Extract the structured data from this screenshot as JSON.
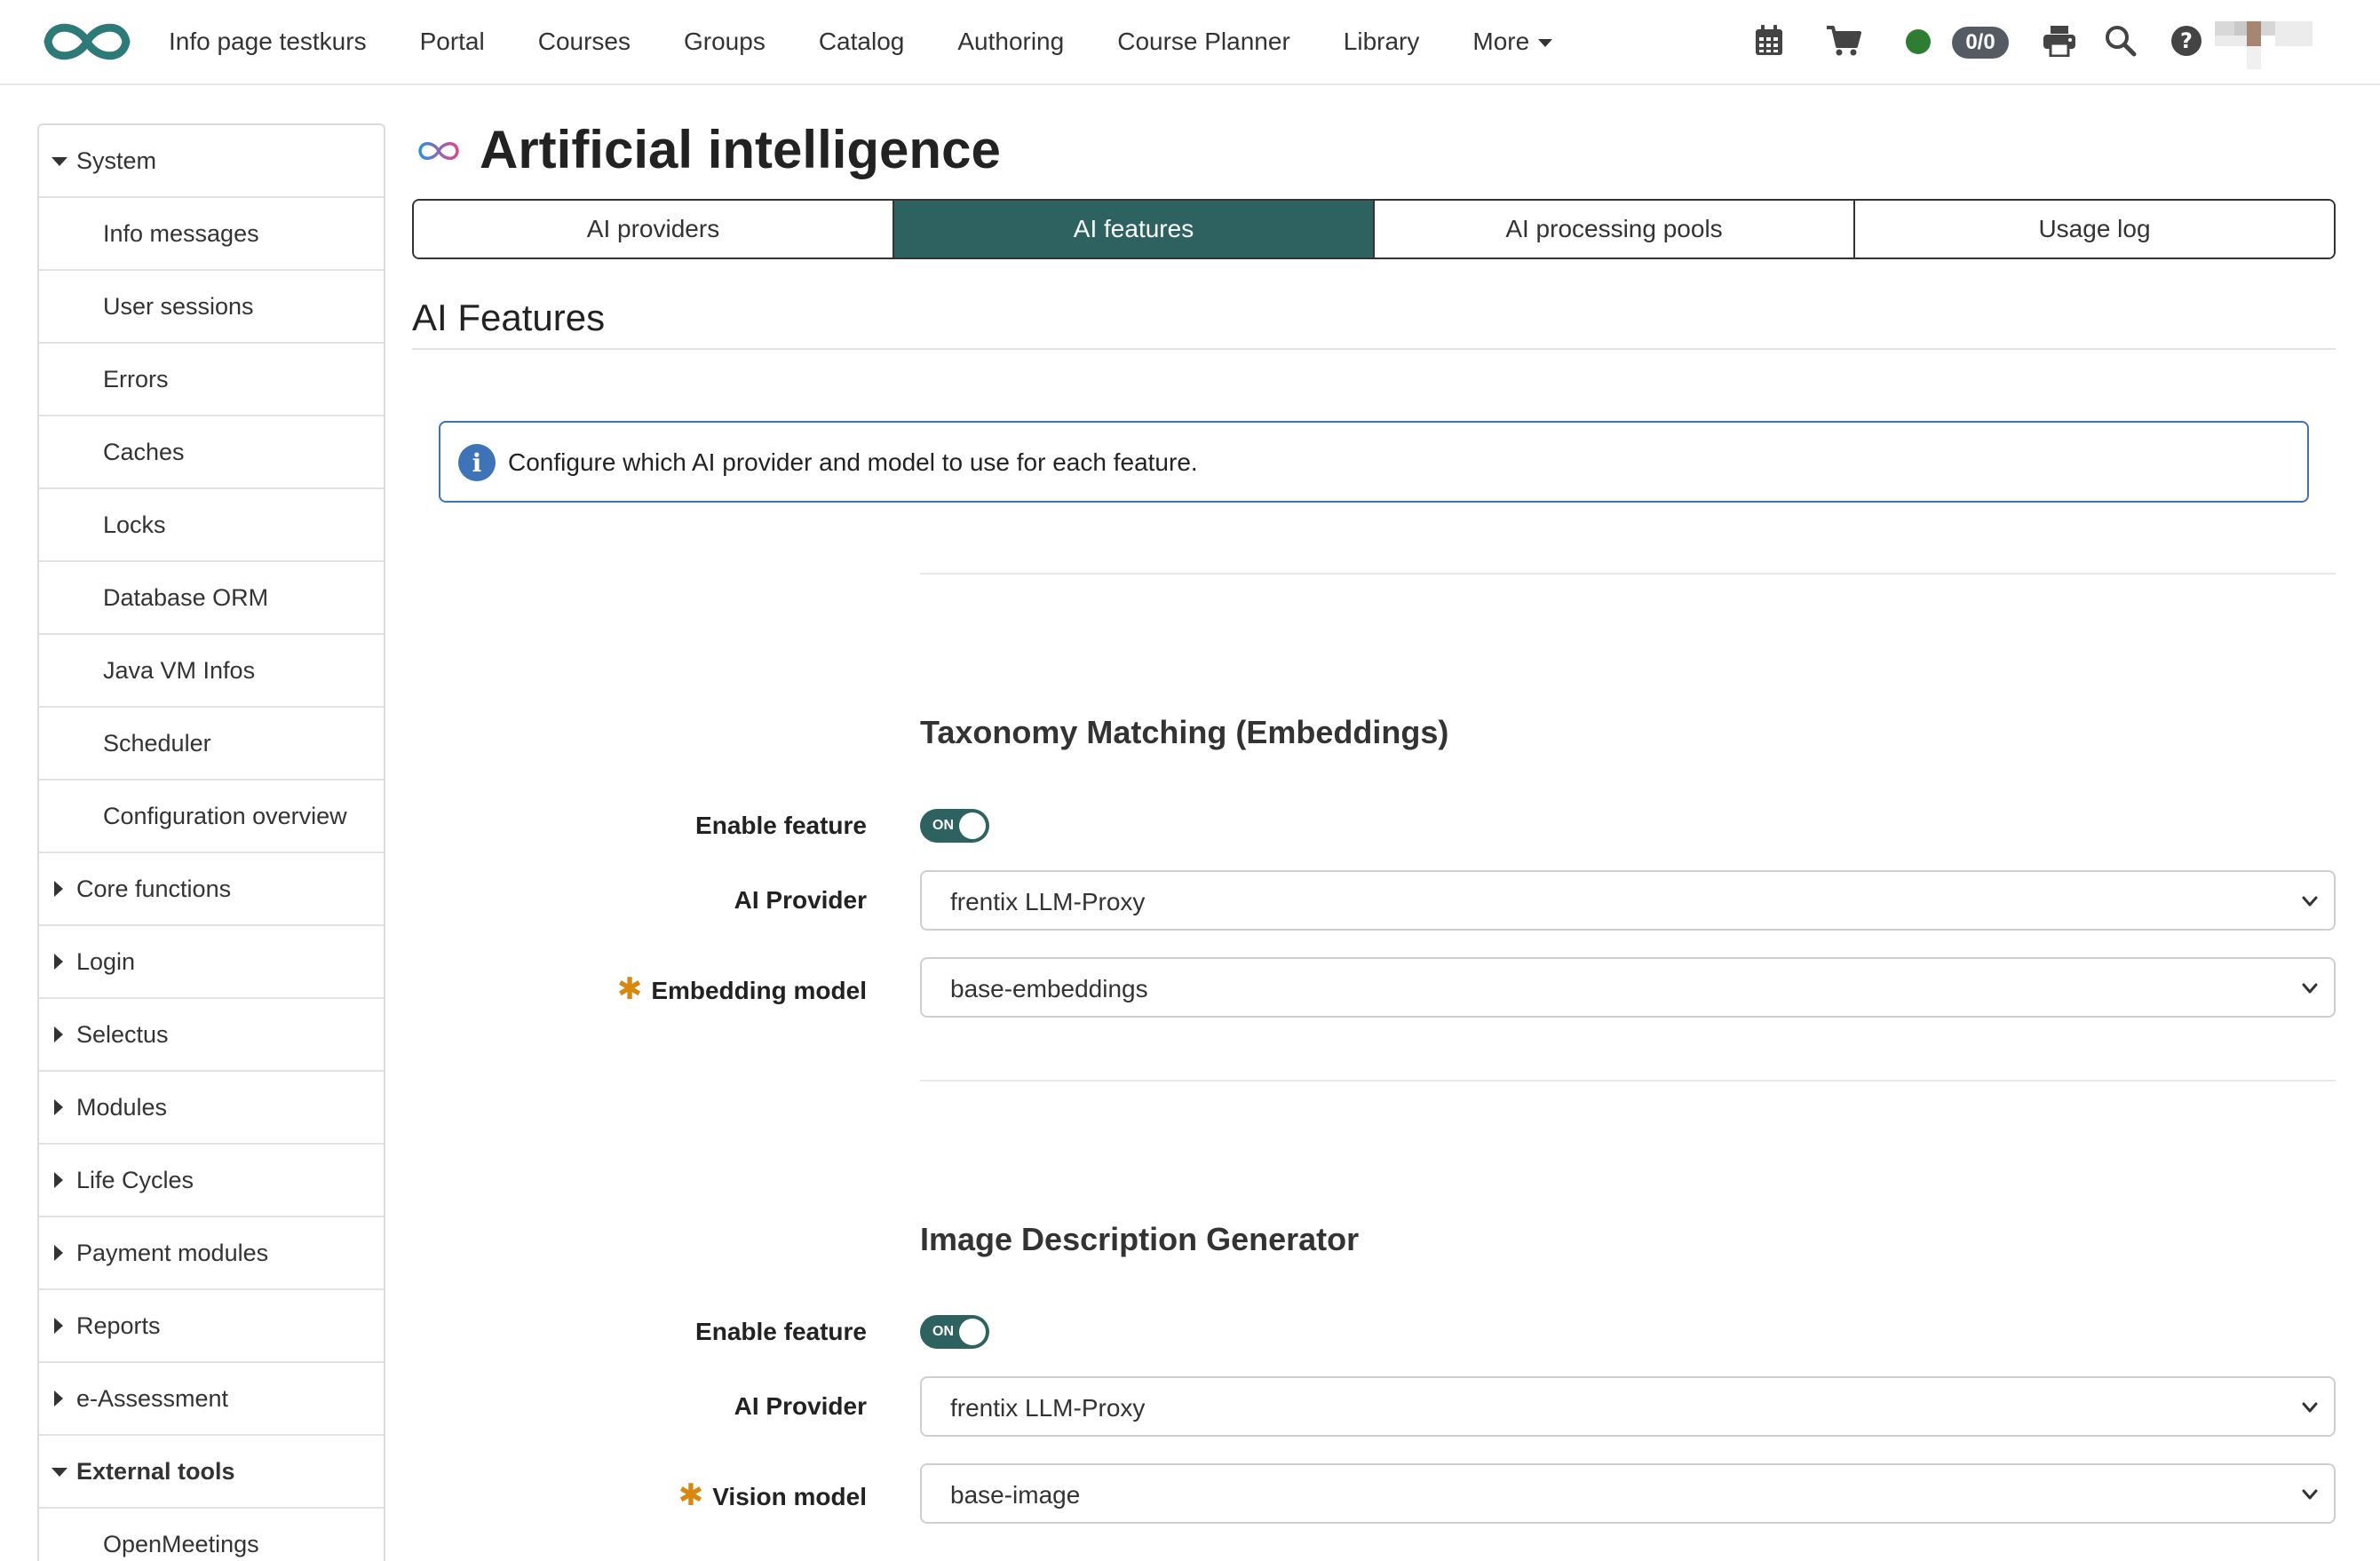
{
  "header": {
    "nav": [
      "Info page testkurs",
      "Portal",
      "Courses",
      "Groups",
      "Catalog",
      "Authoring",
      "Course Planner",
      "Library"
    ],
    "more_label": "More",
    "badge_count": "0/0",
    "icons": [
      "calendar-icon",
      "cart-icon",
      "status-dot",
      "printer-icon",
      "search-icon",
      "help-icon"
    ]
  },
  "sidebar": {
    "system_label": "System",
    "system_items": [
      "Info messages",
      "User sessions",
      "Errors",
      "Caches",
      "Locks",
      "Database ORM",
      "Java VM Infos",
      "Scheduler",
      "Configuration overview"
    ],
    "collapsed_groups": [
      "Core functions",
      "Login",
      "Selectus",
      "Modules",
      "Life Cycles",
      "Payment modules",
      "Reports",
      "e-Assessment"
    ],
    "external_label": "External tools",
    "external_items": [
      "OpenMeetings"
    ]
  },
  "page": {
    "title": "Artificial intelligence",
    "tabs": [
      "AI providers",
      "AI features",
      "AI processing pools",
      "Usage log"
    ],
    "active_tab": 1,
    "section_title": "AI Features",
    "info_text": "Configure which AI provider and model to use for each feature."
  },
  "features": [
    {
      "title": "Taxonomy Matching (Embeddings)",
      "enable_label": "Enable feature",
      "toggle_text": "ON",
      "provider_label": "AI Provider",
      "provider_value": "frentix LLM-Proxy",
      "model_label": "Embedding model",
      "model_value": "base-embeddings"
    },
    {
      "title": "Image Description Generator",
      "enable_label": "Enable feature",
      "toggle_text": "ON",
      "provider_label": "AI Provider",
      "provider_value": "frentix LLM-Proxy",
      "model_label": "Vision model",
      "model_value": "base-image"
    }
  ],
  "colors": {
    "accent": "#2d6260",
    "info": "#3f73b8",
    "required": "#d8870f",
    "status_online": "#2e7d32"
  }
}
